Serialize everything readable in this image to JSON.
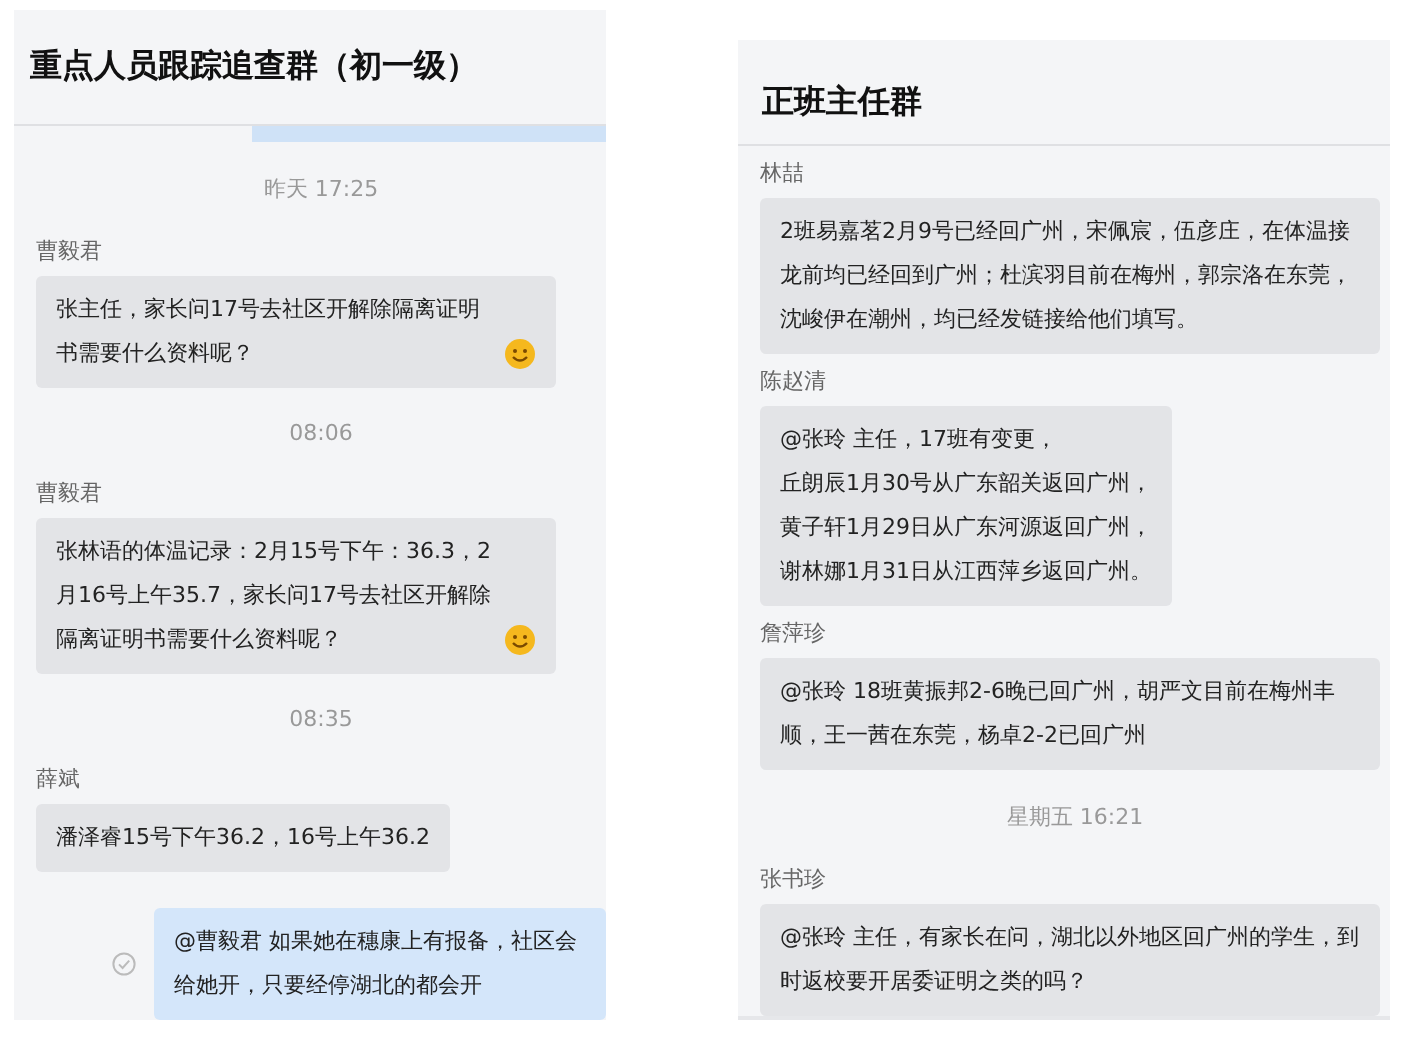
{
  "chats": [
    {
      "title": "重点人员跟踪追查群（初一级）",
      "loading": true,
      "messages": [
        {
          "kind": "time",
          "text": "昨天 17:25"
        },
        {
          "kind": "incoming",
          "sender": "曹毅君",
          "text": "张主任，家长问17号去社区开解除隔离证明书需要什么资料呢？",
          "emoji": true
        },
        {
          "kind": "time",
          "text": "08:06"
        },
        {
          "kind": "incoming",
          "sender": "曹毅君",
          "text": "张林语的体温记录：2月15号下午：36.3，2月16号上午35.7，家长问17号去社区开解除隔离证明书需要什么资料呢？",
          "emoji": true
        },
        {
          "kind": "time",
          "text": "08:35"
        },
        {
          "kind": "incoming",
          "sender": "薛斌",
          "text": "潘泽睿15号下午36.2，16号上午36.2",
          "emoji": false
        },
        {
          "kind": "outgoing",
          "text": "@曹毅君  如果她在穗康上有报备，社区会给她开，只要经停湖北的都会开",
          "sent": true
        }
      ]
    },
    {
      "title": "正班主任群",
      "loading": false,
      "messages": [
        {
          "kind": "incoming",
          "sender": "林喆",
          "text": "2班易嘉茗2月9号已经回广州，宋佩宸，伍彦庄，在体温接龙前均已经回到广州；杜滨羽目前在梅州，郭宗洛在东莞，沈峻伊在潮州，均已经发链接给他们填写。",
          "emoji": false
        },
        {
          "kind": "incoming",
          "sender": "陈赵清",
          "lines": [
            "@张玲 主任，17班有变更，",
            "丘朗辰1月30号从广东韶关返回广州，",
            "黄子轩1月29日从广东河源返回广州，",
            "谢林娜1月31日从江西萍乡返回广州。"
          ],
          "emoji": false
        },
        {
          "kind": "incoming",
          "sender": "詹萍珍",
          "text": "@张玲  18班黄振邦2-6晚已回广州，胡严文目前在梅州丰顺，王一茜在东莞，杨卓2-2已回广州",
          "emoji": false
        },
        {
          "kind": "time",
          "text": "星期五 16:21"
        },
        {
          "kind": "incoming",
          "sender": "张书珍",
          "text": "@张玲 主任，有家长在问，湖北以外地区回广州的学生，到时返校要开居委证明之类的吗？",
          "emoji": false
        }
      ]
    }
  ]
}
